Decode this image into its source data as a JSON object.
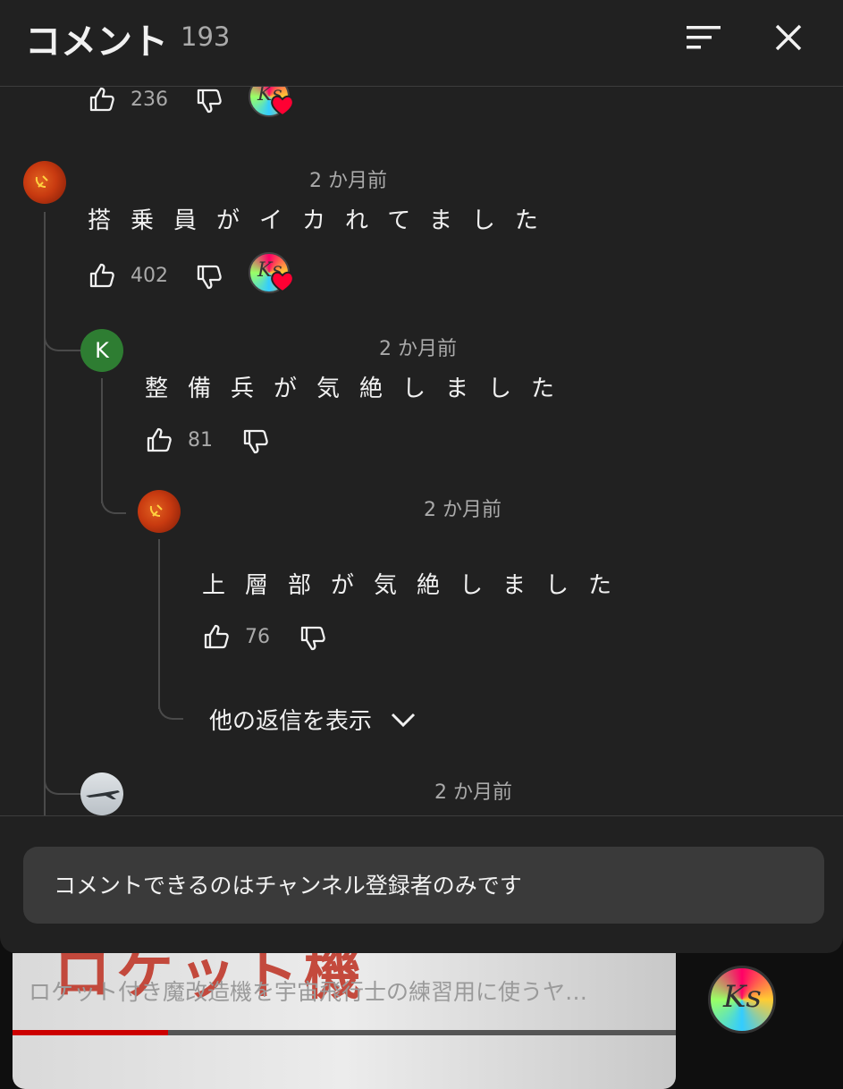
{
  "header": {
    "title": "コメント",
    "count": "193"
  },
  "comments": [
    {
      "likes": "236"
    },
    {
      "time": "2 か月前",
      "text": "搭乗員がイカれてました",
      "likes": "402"
    },
    {
      "avatar_letter": "K",
      "time": "2 か月前",
      "text": "整備兵が気絶しました",
      "likes": "81"
    },
    {
      "time": "2 か月前",
      "text": "上層部が気絶しました",
      "likes": "76"
    },
    {
      "time": "2 か月前"
    }
  ],
  "more_replies_label": "他の返信を表示",
  "compose": {
    "placeholder": "コメントできるのはチャンネル登録者のみです"
  },
  "video": {
    "title": "ロケット付き魔改造機を宇宙飛行士の練習用に使うヤ…",
    "progress": 0.235,
    "thumbnail_text": "ロケット機"
  },
  "creator_logo": {
    "letters": "Ks"
  },
  "colors": {
    "background": "#212121",
    "accent_red": "#cc0000",
    "heart": "#ff0033",
    "avatar_k": "#2e7d32"
  }
}
